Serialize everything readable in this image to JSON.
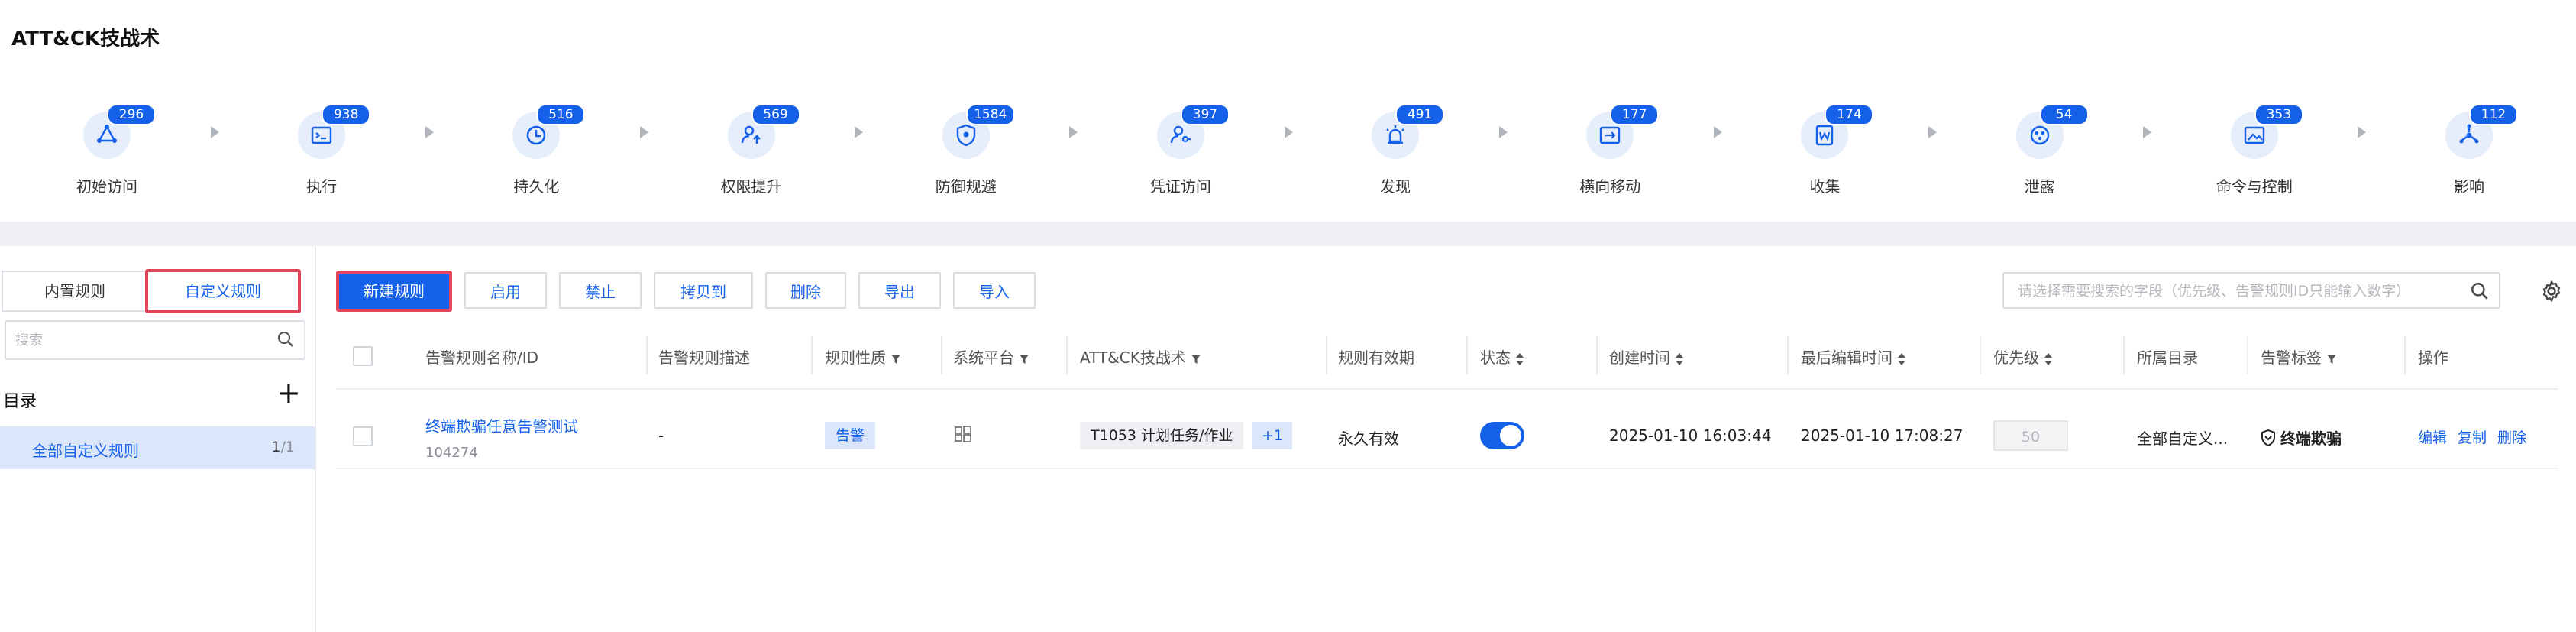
{
  "page": {
    "title": "ATT&CK技战术"
  },
  "tactics": [
    {
      "label": "初始访问",
      "count": "296",
      "icon": "network-triangle-icon"
    },
    {
      "label": "执行",
      "count": "938",
      "icon": "terminal-icon"
    },
    {
      "label": "持久化",
      "count": "516",
      "icon": "clock-icon"
    },
    {
      "label": "权限提升",
      "count": "569",
      "icon": "user-up-icon"
    },
    {
      "label": "防御规避",
      "count": "1584",
      "icon": "shield-eye-icon"
    },
    {
      "label": "凭证访问",
      "count": "397",
      "icon": "user-key-icon"
    },
    {
      "label": "发现",
      "count": "491",
      "icon": "alarm-icon"
    },
    {
      "label": "横向移动",
      "count": "177",
      "icon": "lateral-move-icon"
    },
    {
      "label": "收集",
      "count": "174",
      "icon": "document-icon"
    },
    {
      "label": "泄露",
      "count": "54",
      "icon": "exfil-icon"
    },
    {
      "label": "命令与控制",
      "count": "353",
      "icon": "image-control-icon"
    },
    {
      "label": "影响",
      "count": "112",
      "icon": "impact-icon"
    }
  ],
  "left": {
    "seg_builtin": "内置规则",
    "seg_custom": "自定义规则",
    "search_placeholder": "搜索",
    "dir_title": "目录",
    "dir_add": "+",
    "dir_item_label": "全部自定义规则",
    "dir_item_count": "1",
    "dir_item_total": "/1"
  },
  "toolbar": {
    "new": "新建规则",
    "enable": "启用",
    "disable": "禁止",
    "copy_to": "拷贝到",
    "delete": "删除",
    "export": "导出",
    "import": "导入",
    "search_placeholder": "请选择需要搜索的字段（优先级、告警规则ID只能输入数字）"
  },
  "table": {
    "headers": {
      "name": "告警规则名称/ID",
      "desc": "告警规则描述",
      "nature": "规则性质",
      "platform": "系统平台",
      "tactic": "ATT&CK技战术",
      "validity": "规则有效期",
      "status": "状态",
      "created": "创建时间",
      "edited": "最后编辑时间",
      "priority": "优先级",
      "category": "所属目录",
      "tag": "告警标签",
      "ops": "操作"
    },
    "row": {
      "name": "终端欺骗任意告警测试",
      "id": "104274",
      "desc": "-",
      "nature": "告警",
      "tactic": "T1053 计划任务/作业",
      "tactic_more": "+1",
      "validity": "永久有效",
      "status_on": true,
      "created": "2025-01-10 16:03:44",
      "edited": "2025-01-10 17:08:27",
      "priority": "50",
      "category": "全部自定义...",
      "tag": "终端欺骗",
      "op_edit": "编辑",
      "op_copy": "复制",
      "op_delete": "删除"
    }
  },
  "colors": {
    "accent": "#1560e8",
    "highlight": "#e5455c",
    "badge": "#1560e8"
  }
}
